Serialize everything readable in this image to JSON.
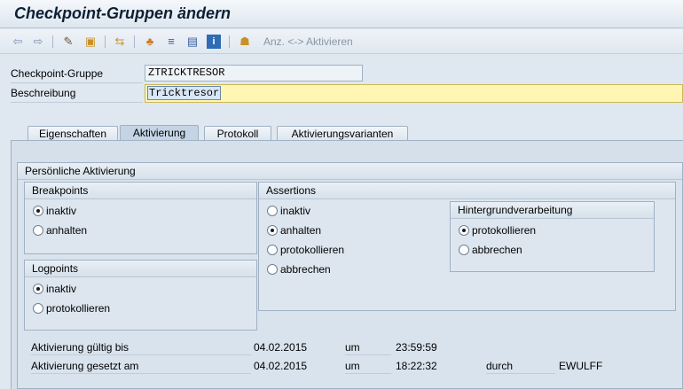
{
  "window": {
    "title": "Checkpoint-Gruppen ändern"
  },
  "toolbar": {
    "icons": [
      "back-icon",
      "forward-icon",
      "display-change-icon",
      "activate-icon",
      "where-used-icon",
      "hierarchy-icon",
      "list-icon",
      "object-list-icon",
      "info-icon",
      "user-icon"
    ],
    "toggle_label": "Anz. <-> Aktivieren"
  },
  "header": {
    "group_label": "Checkpoint-Gruppe",
    "group_value": "ZTRICKTRESOR",
    "description_label": "Beschreibung",
    "description_value": "Tricktresor"
  },
  "tabs": [
    {
      "label": "Eigenschaften",
      "active": false
    },
    {
      "label": "Aktivierung",
      "active": true
    },
    {
      "label": "Protokoll",
      "active": false
    },
    {
      "label": "Aktivierungsvarianten",
      "active": false
    }
  ],
  "activation": {
    "section_title": "Persönliche Aktivierung",
    "breakpoints": {
      "title": "Breakpoints",
      "options": [
        {
          "label": "inaktiv",
          "checked": true
        },
        {
          "label": "anhalten",
          "checked": false
        }
      ]
    },
    "logpoints": {
      "title": "Logpoints",
      "options": [
        {
          "label": "inaktiv",
          "checked": true
        },
        {
          "label": "protokollieren",
          "checked": false
        }
      ]
    },
    "assertions": {
      "title": "Assertions",
      "options": [
        {
          "label": "inaktiv",
          "checked": false
        },
        {
          "label": "anhalten",
          "checked": true
        },
        {
          "label": "protokollieren",
          "checked": false
        },
        {
          "label": "abbrechen",
          "checked": false
        }
      ]
    },
    "background": {
      "title": "Hintergrundverarbeitung",
      "options": [
        {
          "label": "protokollieren",
          "checked": true
        },
        {
          "label": "abbrechen",
          "checked": false
        }
      ]
    }
  },
  "validity": {
    "valid_until_label": "Aktivierung gültig bis",
    "valid_until_date": "04.02.2015",
    "at_label_1": "um",
    "valid_until_time": "23:59:59",
    "set_on_label": "Aktivierung gesetzt am",
    "set_on_date": "04.02.2015",
    "at_label_2": "um",
    "set_on_time": "18:22:32",
    "by_label": "durch",
    "set_by": "EWULFF"
  }
}
